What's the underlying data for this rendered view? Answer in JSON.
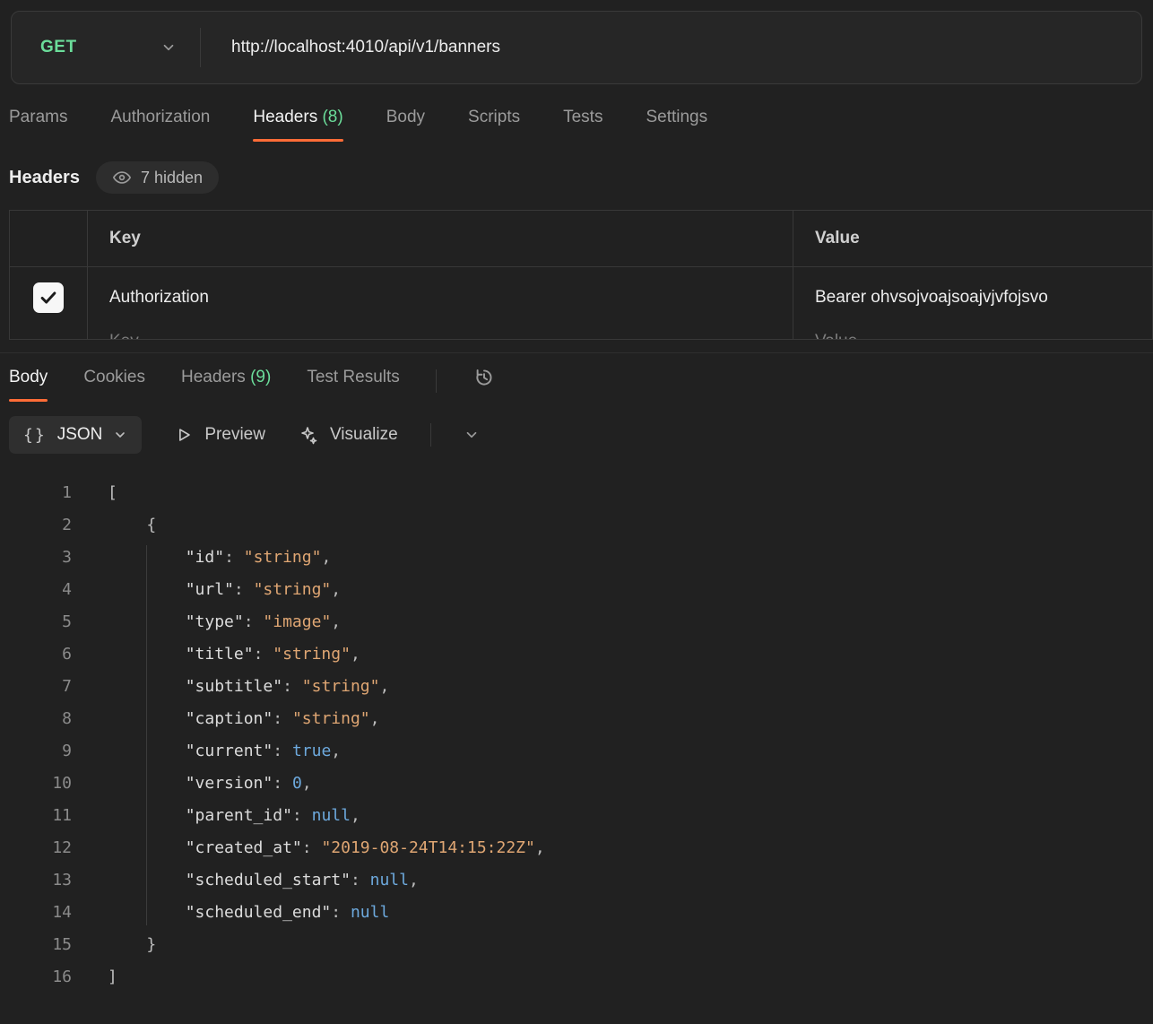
{
  "request": {
    "method": "GET",
    "url": "http://localhost:4010/api/v1/banners"
  },
  "request_tabs": {
    "params": "Params",
    "authorization": "Authorization",
    "headers": "Headers",
    "headers_count": "(8)",
    "body": "Body",
    "scripts": "Scripts",
    "tests": "Tests",
    "settings": "Settings"
  },
  "headers_section": {
    "title": "Headers",
    "hidden_badge": "7 hidden"
  },
  "headers_table": {
    "col_key": "Key",
    "col_value": "Value",
    "rows": [
      {
        "key": "Authorization",
        "value": "Bearer ohvsojvoajsoajvjvfojsvo",
        "checked": true
      }
    ],
    "next_row_key_placeholder": "Key",
    "next_row_value_placeholder": "Value"
  },
  "response_tabs": {
    "body": "Body",
    "cookies": "Cookies",
    "headers": "Headers",
    "headers_count": "(9)",
    "test_results": "Test Results"
  },
  "response_toolbar": {
    "format_icon": "{}",
    "format": "JSON",
    "preview": "Preview",
    "visualize": "Visualize"
  },
  "colors": {
    "accent_orange": "#ff6c37",
    "method_green": "#6bdd9a",
    "string_orange": "#dfa673",
    "literal_blue": "#6da9dd",
    "background": "#212121"
  },
  "response_body": {
    "language": "json",
    "lines": [
      {
        "n": "1",
        "tokens": [
          [
            "p",
            "["
          ]
        ]
      },
      {
        "n": "2",
        "tokens": [
          [
            "p",
            "    {"
          ]
        ]
      },
      {
        "n": "3",
        "tokens": [
          [
            "p",
            "        "
          ],
          [
            "k",
            "\"id\""
          ],
          [
            "p",
            ": "
          ],
          [
            "s",
            "\"string\""
          ],
          [
            "p",
            ","
          ]
        ]
      },
      {
        "n": "4",
        "tokens": [
          [
            "p",
            "        "
          ],
          [
            "k",
            "\"url\""
          ],
          [
            "p",
            ": "
          ],
          [
            "s",
            "\"string\""
          ],
          [
            "p",
            ","
          ]
        ]
      },
      {
        "n": "5",
        "tokens": [
          [
            "p",
            "        "
          ],
          [
            "k",
            "\"type\""
          ],
          [
            "p",
            ": "
          ],
          [
            "s",
            "\"image\""
          ],
          [
            "p",
            ","
          ]
        ]
      },
      {
        "n": "6",
        "tokens": [
          [
            "p",
            "        "
          ],
          [
            "k",
            "\"title\""
          ],
          [
            "p",
            ": "
          ],
          [
            "s",
            "\"string\""
          ],
          [
            "p",
            ","
          ]
        ]
      },
      {
        "n": "7",
        "tokens": [
          [
            "p",
            "        "
          ],
          [
            "k",
            "\"subtitle\""
          ],
          [
            "p",
            ": "
          ],
          [
            "s",
            "\"string\""
          ],
          [
            "p",
            ","
          ]
        ]
      },
      {
        "n": "8",
        "tokens": [
          [
            "p",
            "        "
          ],
          [
            "k",
            "\"caption\""
          ],
          [
            "p",
            ": "
          ],
          [
            "s",
            "\"string\""
          ],
          [
            "p",
            ","
          ]
        ]
      },
      {
        "n": "9",
        "tokens": [
          [
            "p",
            "        "
          ],
          [
            "k",
            "\"current\""
          ],
          [
            "p",
            ": "
          ],
          [
            "b",
            "true"
          ],
          [
            "p",
            ","
          ]
        ]
      },
      {
        "n": "10",
        "tokens": [
          [
            "p",
            "        "
          ],
          [
            "k",
            "\"version\""
          ],
          [
            "p",
            ": "
          ],
          [
            "b",
            "0"
          ],
          [
            "p",
            ","
          ]
        ]
      },
      {
        "n": "11",
        "tokens": [
          [
            "p",
            "        "
          ],
          [
            "k",
            "\"parent_id\""
          ],
          [
            "p",
            ": "
          ],
          [
            "b",
            "null"
          ],
          [
            "p",
            ","
          ]
        ]
      },
      {
        "n": "12",
        "tokens": [
          [
            "p",
            "        "
          ],
          [
            "k",
            "\"created_at\""
          ],
          [
            "p",
            ": "
          ],
          [
            "s",
            "\"2019-08-24T14:15:22Z\""
          ],
          [
            "p",
            ","
          ]
        ]
      },
      {
        "n": "13",
        "tokens": [
          [
            "p",
            "        "
          ],
          [
            "k",
            "\"scheduled_start\""
          ],
          [
            "p",
            ": "
          ],
          [
            "b",
            "null"
          ],
          [
            "p",
            ","
          ]
        ]
      },
      {
        "n": "14",
        "tokens": [
          [
            "p",
            "        "
          ],
          [
            "k",
            "\"scheduled_end\""
          ],
          [
            "p",
            ": "
          ],
          [
            "b",
            "null"
          ]
        ]
      },
      {
        "n": "15",
        "tokens": [
          [
            "p",
            "    }"
          ]
        ]
      },
      {
        "n": "16",
        "tokens": [
          [
            "p",
            "]"
          ]
        ]
      }
    ]
  }
}
